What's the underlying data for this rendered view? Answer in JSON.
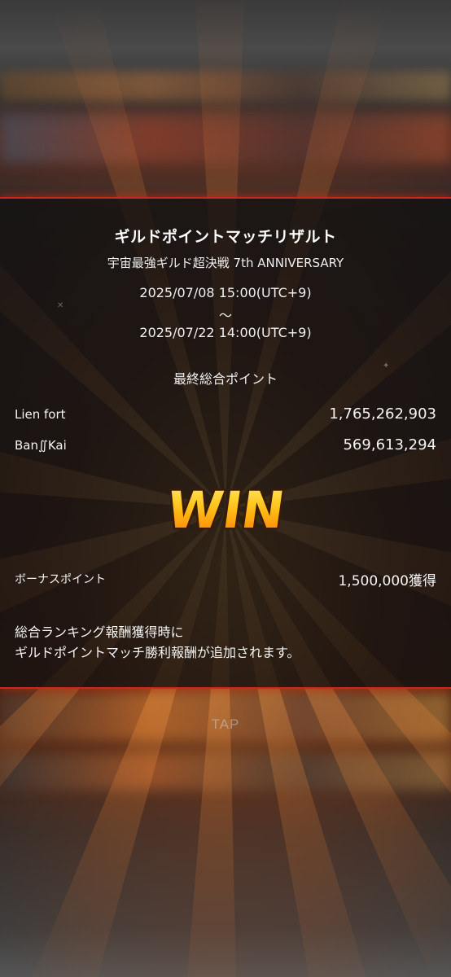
{
  "result": {
    "title": "ギルドポイントマッチリザルト",
    "subtitle": "宇宙最強ギルド超決戦 7th ANNIVERSARY",
    "period": {
      "start": "2025/07/08 15:00(UTC+9)",
      "separator": "～",
      "end": "2025/07/22 14:00(UTC+9)"
    },
    "final_points_heading": "最終総合ポイント",
    "guilds": [
      {
        "name": "Lien fort",
        "points": "1,765,262,903"
      },
      {
        "name": "Ban∬Kai",
        "points": "569,613,294"
      }
    ],
    "outcome": "WIN",
    "bonus": {
      "label": "ボーナスポイント",
      "value": "1,500,000獲得"
    },
    "note_lines": [
      "総合ランキング報酬獲得時に",
      "ギルドポイントマッチ勝利報酬が追加されます。"
    ]
  },
  "tap_prompt": "TAP",
  "colors": {
    "panel_border": "#c62a1c",
    "win_fill_top": "#ffd84a",
    "win_fill_bottom": "#ff8a00",
    "win_stroke": "#3a1a08"
  }
}
